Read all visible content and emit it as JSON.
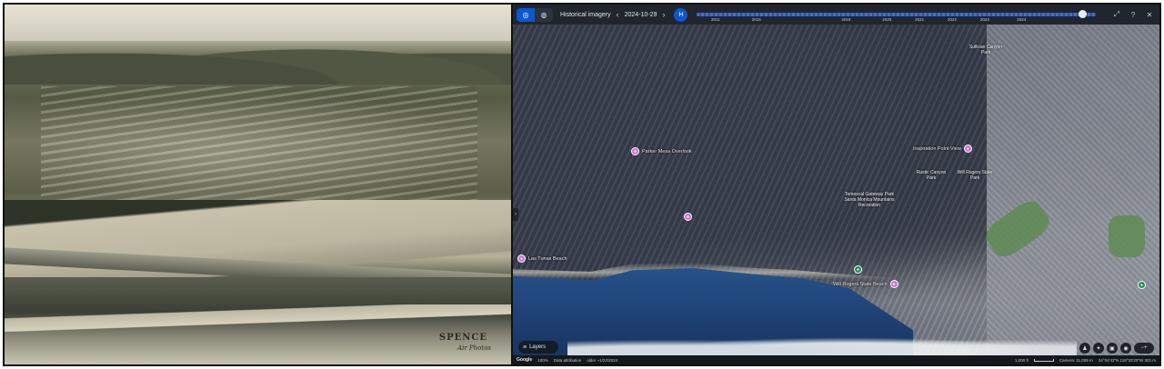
{
  "archive_photo": {
    "watermark_title": "SPENCE",
    "watermark_subtitle": "Air Photos"
  },
  "map": {
    "toolbar": {
      "mode_buttons": [
        "satellite-icon",
        "globe-icon"
      ],
      "title": "Historical imagery",
      "prev_label": "‹",
      "date": "2024-10-29",
      "next_label": "›",
      "play_label": "H",
      "timeline_years": [
        "2011",
        "2016",
        "2019",
        "2020",
        "2021",
        "2022",
        "2023",
        "2024"
      ],
      "right_icons": [
        "collapse-icon",
        "help-icon",
        "close-icon"
      ]
    },
    "places": [
      {
        "name": "Parker Mesa Overlook",
        "type": "poi"
      },
      {
        "name": "Inspiration Point View",
        "type": "poi"
      },
      {
        "name": "Sullivan Canyon Park",
        "type": "place"
      },
      {
        "name": "Rustic Canyon Park",
        "type": "place"
      },
      {
        "name": "Will Rogers State Park",
        "type": "place"
      },
      {
        "name": "Temescal Gateway Park",
        "type": "place"
      },
      {
        "name": "Santa Monica Mountains Recreation",
        "type": "place"
      },
      {
        "name": "Will Rogers State Beach",
        "type": "poi"
      },
      {
        "name": "Las Tunas Beach",
        "type": "poi"
      }
    ],
    "layers_label": "Layers",
    "controls": [
      "person-icon",
      "compass-icon",
      "camera-icon",
      "location-icon",
      "zoom-icon"
    ],
    "status": {
      "logo": "Google",
      "zoom": "100%",
      "data_attribution": "Data attribution",
      "imagery_date": "older ~1/22/2024",
      "scale": "1,000 ft",
      "camera": "Camera: 11,009 m",
      "coords": "34°04'42\"N 118°33'20\"W  302 m"
    }
  }
}
